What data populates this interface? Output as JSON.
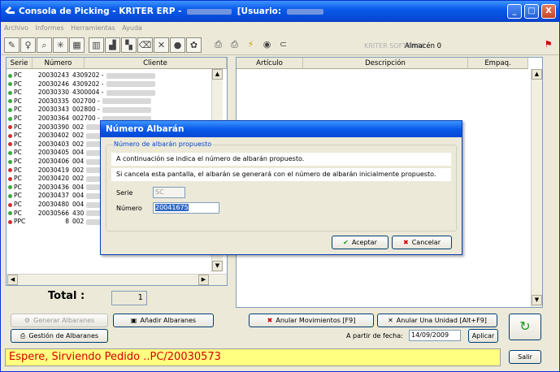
{
  "window": {
    "title": "Consola de Picking - KRITER ERP -",
    "title_user": "[Usuario:",
    "controls": [
      "_",
      "□",
      "X"
    ]
  },
  "menu": [
    "Archivo",
    "Informes",
    "Herramientas",
    "Ayuda"
  ],
  "toolbar": {
    "kriter_label": "KRITER SOFTWARE",
    "warehouse": "Almacén 0"
  },
  "left_table": {
    "columns": [
      "Serie",
      "Número",
      "Cliente"
    ],
    "rows": [
      {
        "serie": "PC",
        "numero": "20030243",
        "cliente": "4309202 -",
        "color": "#3caa3c"
      },
      {
        "serie": "PC",
        "numero": "20030246",
        "cliente": "4309202 -",
        "color": "#3caa3c"
      },
      {
        "serie": "PC",
        "numero": "20030330",
        "cliente": "4300004 -",
        "color": "#3caa3c"
      },
      {
        "serie": "PC",
        "numero": "20030335",
        "cliente": "002700 -",
        "color": "#3caa3c"
      },
      {
        "serie": "PC",
        "numero": "20030343",
        "cliente": "002800 -",
        "color": "#3caa3c"
      },
      {
        "serie": "PC",
        "numero": "20030364",
        "cliente": "002700 -",
        "color": "#3caa3c"
      },
      {
        "serie": "PC",
        "numero": "20030390",
        "cliente": "002",
        "color": "#d03030"
      },
      {
        "serie": "PC",
        "numero": "20030402",
        "cliente": "002",
        "color": "#d03030"
      },
      {
        "serie": "PC",
        "numero": "20030403",
        "cliente": "002",
        "color": "#d03030"
      },
      {
        "serie": "PC",
        "numero": "20030405",
        "cliente": "004",
        "color": "#3caa3c"
      },
      {
        "serie": "PC",
        "numero": "20030406",
        "cliente": "004",
        "color": "#3caa3c"
      },
      {
        "serie": "PC",
        "numero": "20030419",
        "cliente": "002",
        "color": "#d03030"
      },
      {
        "serie": "PC",
        "numero": "20030420",
        "cliente": "002",
        "color": "#d03030"
      },
      {
        "serie": "PC",
        "numero": "20030436",
        "cliente": "004",
        "color": "#3caa3c"
      },
      {
        "serie": "PC",
        "numero": "20030437",
        "cliente": "004",
        "color": "#3caa3c"
      },
      {
        "serie": "PC",
        "numero": "20030480",
        "cliente": "004",
        "color": "#d03030"
      },
      {
        "serie": "PC",
        "numero": "20030566",
        "cliente": "430",
        "color": "#3caa3c"
      },
      {
        "serie": "PPC",
        "numero": "8",
        "cliente": "002",
        "color": "#d03030"
      }
    ]
  },
  "total": {
    "label": "Total :",
    "value": "1"
  },
  "right_table": {
    "columns": [
      "Artículo",
      "Descripción",
      "Empaq."
    ]
  },
  "buttons": {
    "generar": "Generar Albaranes",
    "anadir": "Añadir Albaranes",
    "gestion": "Gestión de Albaranes",
    "anular_mov": "Anular Movimientos [F9]",
    "anular_unidad": "Anular Una Unidad [Alt+F9]",
    "aplicar": "Aplicar",
    "salir": "Salir"
  },
  "fecha": {
    "label": "A partir de fecha:",
    "value": "14/09/2009"
  },
  "status": "Espere, Sirviendo Pedido ..PC/20030573",
  "dialog": {
    "title": "Número Albarán",
    "group_label": "Número de albarán propuesto",
    "line1": "A continuación se indica el número de albarán propuesto.",
    "line2": "Si cancela esta pantalla, el albarán se generará con el número de albarán inicialmente propuesto.",
    "serie_label": "Serie",
    "serie_value": "SC",
    "numero_label": "Número",
    "numero_value": "20041675",
    "accept": "Aceptar",
    "cancel": "Cancelar"
  },
  "colors": {
    "title": "#0a5ae9",
    "status_bg": "#ffff80",
    "status_text": "#d40000"
  }
}
